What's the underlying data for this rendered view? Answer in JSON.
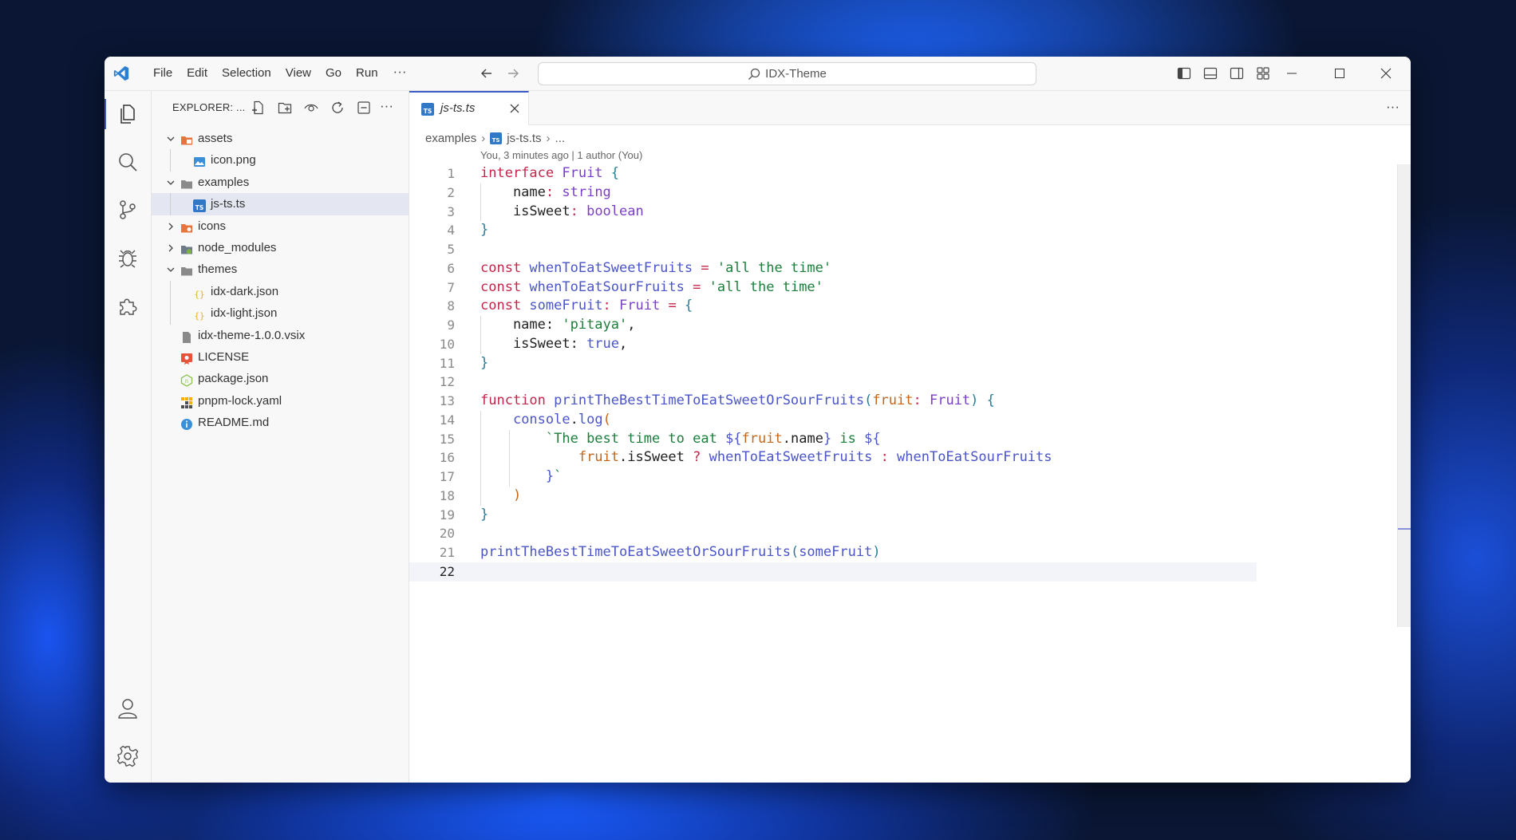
{
  "titlebar": {
    "menu": [
      "File",
      "Edit",
      "Selection",
      "View",
      "Go",
      "Run"
    ],
    "menu_more": "···",
    "search_text": "IDX-Theme"
  },
  "sidebar": {
    "title": "EXPLORER: ...",
    "more": "···",
    "tree": [
      {
        "name": "assets",
        "kind": "folder",
        "open": true,
        "depth": 0
      },
      {
        "name": "icon.png",
        "kind": "image",
        "depth": 1
      },
      {
        "name": "examples",
        "kind": "folder",
        "open": true,
        "depth": 0
      },
      {
        "name": "js-ts.ts",
        "kind": "ts",
        "depth": 1,
        "selected": true
      },
      {
        "name": "icons",
        "kind": "folder",
        "open": false,
        "depth": 0
      },
      {
        "name": "node_modules",
        "kind": "folder",
        "open": false,
        "depth": 0
      },
      {
        "name": "themes",
        "kind": "folder",
        "open": true,
        "depth": 0
      },
      {
        "name": "idx-dark.json",
        "kind": "json",
        "depth": 1
      },
      {
        "name": "idx-light.json",
        "kind": "json",
        "depth": 1
      },
      {
        "name": "idx-theme-1.0.0.vsix",
        "kind": "file",
        "depth": 0
      },
      {
        "name": "LICENSE",
        "kind": "license",
        "depth": 0
      },
      {
        "name": "package.json",
        "kind": "npm",
        "depth": 0
      },
      {
        "name": "pnpm-lock.yaml",
        "kind": "pnpm",
        "depth": 0
      },
      {
        "name": "README.md",
        "kind": "info",
        "depth": 0
      }
    ]
  },
  "editor": {
    "tab_label": "js-ts.ts",
    "tabs_more": "···",
    "breadcrumb": [
      "examples",
      "js-ts.ts",
      "..."
    ],
    "blame": "You, 3 minutes ago | 1 author (You)",
    "current_line": 22,
    "lines": [
      [
        [
          "kw",
          "interface "
        ],
        [
          "ty",
          "Fruit "
        ],
        [
          "br",
          "{"
        ]
      ],
      [
        [
          "pn",
          "    name"
        ],
        [
          "kw",
          ": "
        ],
        [
          "ty",
          "string"
        ]
      ],
      [
        [
          "pn",
          "    isSweet"
        ],
        [
          "kw",
          ": "
        ],
        [
          "ty",
          "boolean"
        ]
      ],
      [
        [
          "br",
          "}"
        ]
      ],
      [],
      [
        [
          "kw",
          "const "
        ],
        [
          "fn",
          "whenToEatSweetFruits "
        ],
        [
          "kw",
          "= "
        ],
        [
          "st",
          "'all the time'"
        ]
      ],
      [
        [
          "kw",
          "const "
        ],
        [
          "fn",
          "whenToEatSourFruits "
        ],
        [
          "kw",
          "= "
        ],
        [
          "st",
          "'all the time'"
        ]
      ],
      [
        [
          "kw",
          "const "
        ],
        [
          "fn",
          "someFruit"
        ],
        [
          "kw",
          ": "
        ],
        [
          "ty",
          "Fruit "
        ],
        [
          "kw",
          "= "
        ],
        [
          "br",
          "{"
        ]
      ],
      [
        [
          "pn",
          "    name: "
        ],
        [
          "st",
          "'pitaya'"
        ],
        [
          "pn",
          ","
        ]
      ],
      [
        [
          "pn",
          "    isSweet: "
        ],
        [
          "fn",
          "true"
        ],
        [
          "pn",
          ","
        ]
      ],
      [
        [
          "br",
          "}"
        ]
      ],
      [],
      [
        [
          "kw",
          "function "
        ],
        [
          "fn",
          "printTheBestTimeToEatSweetOrSourFruits"
        ],
        [
          "br",
          "("
        ],
        [
          "pm",
          "fruit"
        ],
        [
          "kw",
          ": "
        ],
        [
          "ty",
          "Fruit"
        ],
        [
          "br",
          ") {"
        ]
      ],
      [
        [
          "pn",
          "    "
        ],
        [
          "fn",
          "console"
        ],
        [
          "pn",
          "."
        ],
        [
          "fn",
          "log"
        ],
        [
          "pm",
          "("
        ]
      ],
      [
        [
          "pn",
          "        "
        ],
        [
          "st",
          "`The best time to eat "
        ],
        [
          "fn",
          "${"
        ],
        [
          "pm",
          "fruit"
        ],
        [
          "pn",
          "."
        ],
        [
          "pn",
          "name"
        ],
        [
          "fn",
          "}"
        ],
        [
          "st",
          " is "
        ],
        [
          "fn",
          "${"
        ]
      ],
      [
        [
          "pn",
          "            "
        ],
        [
          "pm",
          "fruit"
        ],
        [
          "pn",
          ".isSweet "
        ],
        [
          "kw",
          "? "
        ],
        [
          "fn",
          "whenToEatSweetFruits "
        ],
        [
          "kw",
          ": "
        ],
        [
          "fn",
          "whenToEatSourFruits"
        ]
      ],
      [
        [
          "pn",
          "        "
        ],
        [
          "fn",
          "}"
        ],
        [
          "st",
          "`"
        ]
      ],
      [
        [
          "pn",
          "    "
        ],
        [
          "pm",
          ")"
        ]
      ],
      [
        [
          "br",
          "}"
        ]
      ],
      [],
      [
        [
          "fn",
          "printTheBestTimeToEatSweetOrSourFruits"
        ],
        [
          "br",
          "("
        ],
        [
          "fn",
          "someFruit"
        ],
        [
          "br",
          ")"
        ]
      ],
      []
    ]
  }
}
